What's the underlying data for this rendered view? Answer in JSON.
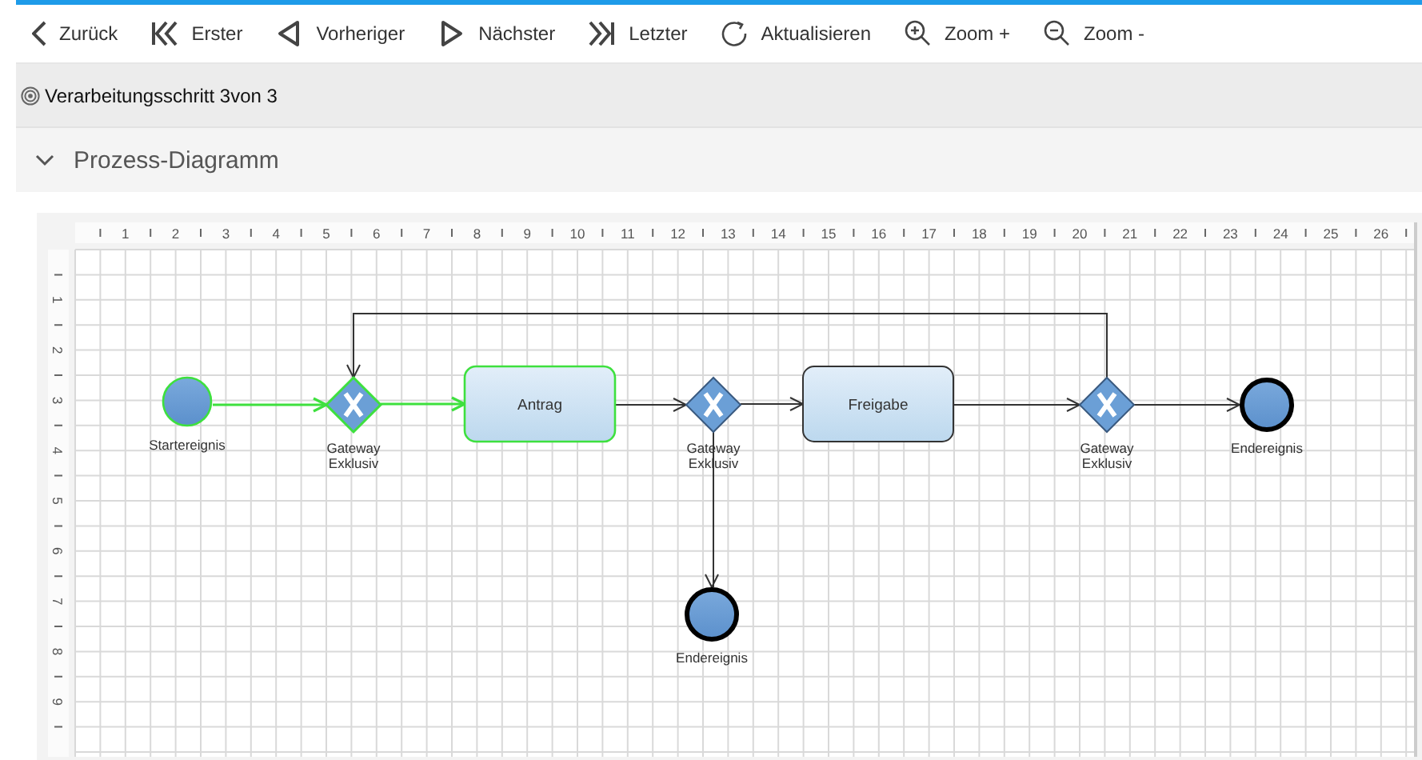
{
  "toolbar": [
    {
      "label": "Zurück"
    },
    {
      "label": "Erster"
    },
    {
      "label": "Vorheriger"
    },
    {
      "label": "Nächster"
    },
    {
      "label": "Letzter"
    },
    {
      "label": "Aktualisieren"
    },
    {
      "label": "Zoom +"
    },
    {
      "label": "Zoom -"
    }
  ],
  "step_bar": {
    "text": "Verarbeitungsschritt 3von 3"
  },
  "panel": {
    "title": "Prozess-Diagramm",
    "expanded": true
  },
  "ruler": {
    "x_labels": [
      "1",
      "2",
      "3",
      "4",
      "5",
      "6",
      "7",
      "8",
      "9",
      "10",
      "11",
      "12",
      "13",
      "14",
      "15",
      "16",
      "17",
      "18",
      "19",
      "20",
      "21",
      "22",
      "23",
      "24",
      "25",
      "26"
    ],
    "y_labels": [
      "1",
      "2",
      "3",
      "4",
      "5",
      "6",
      "7",
      "8",
      "9"
    ]
  },
  "diagram": {
    "nodes": [
      {
        "kind": "start",
        "label": "Startereignis",
        "highlighted": true
      },
      {
        "kind": "gateway",
        "label": "Gateway Exklusiv",
        "highlighted": true
      },
      {
        "kind": "task",
        "label": "Antrag",
        "highlighted": true
      },
      {
        "kind": "gateway",
        "label": "Gateway Exklusiv",
        "highlighted": false
      },
      {
        "kind": "task",
        "label": "Freigabe",
        "highlighted": false
      },
      {
        "kind": "gateway",
        "label": "Gateway Exklusiv",
        "highlighted": false
      },
      {
        "kind": "end",
        "label": "Endereignis",
        "highlighted": false
      },
      {
        "kind": "end",
        "label": "Endereignis",
        "highlighted": false
      }
    ],
    "edges": [
      {
        "highlighted": true
      },
      {
        "highlighted": true
      },
      {
        "highlighted": false
      },
      {
        "highlighted": false
      },
      {
        "highlighted": false
      },
      {
        "highlighted": false
      },
      {
        "highlighted": false
      },
      {
        "highlighted": false
      }
    ]
  }
}
